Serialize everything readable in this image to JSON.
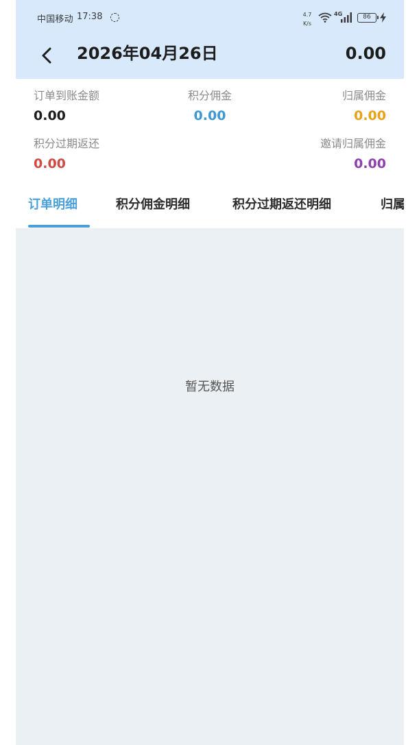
{
  "status_bar": {
    "carrier": "中国移动",
    "time": "17:38",
    "net_speed_value": "4.7",
    "net_speed_unit": "K/s",
    "network_type": "4G",
    "battery": "86",
    "icons": [
      "sync-icon",
      "wifi-icon",
      "signal-icon",
      "battery-icon",
      "charging-icon"
    ]
  },
  "header": {
    "title": "2026年04月26日",
    "total": "0.00",
    "background": "#d7e9fb"
  },
  "stats": {
    "order_amount": {
      "label": "订单到账金额",
      "value": "0.00",
      "color": "#1c1c1c"
    },
    "points_commission": {
      "label": "积分佣金",
      "value": "0.00",
      "color": "#3d97d3"
    },
    "attribution_commission": {
      "label": "归属佣金",
      "value": "0.00",
      "color": "#e8a21a"
    },
    "points_expired_refund": {
      "label": "积分过期返还",
      "value": "0.00",
      "color": "#cf4a44"
    },
    "invite_attribution_commission": {
      "label": "邀请归属佣金",
      "value": "0.00",
      "color": "#8e3fb0"
    }
  },
  "tabs": [
    {
      "label": "订单明细",
      "active": true
    },
    {
      "label": "积分佣金明细",
      "active": false
    },
    {
      "label": "积分过期返还明细",
      "active": false
    },
    {
      "label": "归属",
      "active": false
    }
  ],
  "content": {
    "empty_text": "暂无数据"
  },
  "colors": {
    "accent": "#4a9fd8",
    "content_background": "#ebf0f5"
  }
}
